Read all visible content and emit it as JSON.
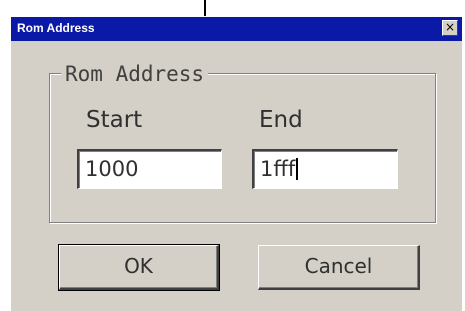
{
  "window": {
    "title": "Rom Address",
    "close_glyph": "×"
  },
  "group": {
    "label": "Rom Address"
  },
  "fields": {
    "start_label": "Start",
    "start_value": "1000",
    "end_label": "End",
    "end_value": "1fff"
  },
  "buttons": {
    "ok_label": "OK",
    "cancel_label": "Cancel"
  },
  "annotation": {
    "icon": "down-arrow-icon"
  },
  "colors": {
    "titlebar": "#0a1aa6",
    "face": "#d4d0c8"
  }
}
